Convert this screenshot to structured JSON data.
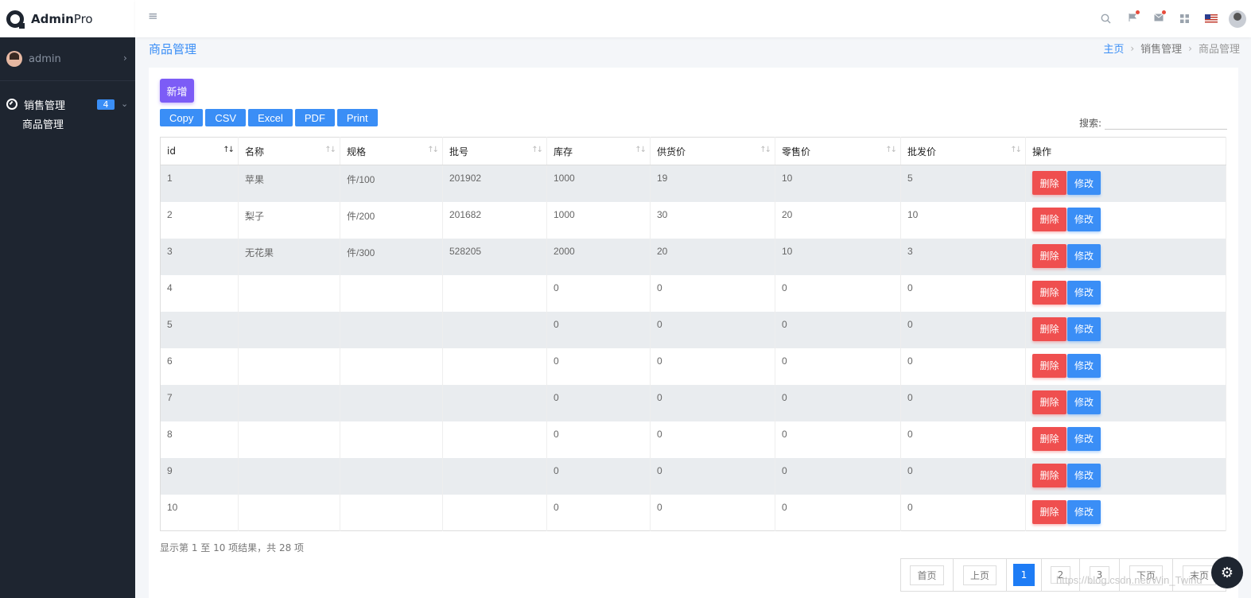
{
  "brand": {
    "name_bold": "Admin",
    "name_light": "Pro"
  },
  "topbar": {
    "icons": [
      "search-icon",
      "flag-icon",
      "mail-icon",
      "grid-icon",
      "us-flag-icon",
      "user-avatar"
    ]
  },
  "sidebar": {
    "user": "admin",
    "menu": {
      "label": "销售管理",
      "badge": "4",
      "items": [
        {
          "label": "商品管理"
        }
      ]
    }
  },
  "page": {
    "title": "商品管理"
  },
  "breadcrumb": {
    "home": "主页",
    "section": "销售管理",
    "current": "商品管理"
  },
  "toolbar": {
    "add_label": "新增",
    "export": [
      "Copy",
      "CSV",
      "Excel",
      "PDF",
      "Print"
    ],
    "search_label": "搜索:",
    "search_value": ""
  },
  "table": {
    "columns": [
      "id",
      "名称",
      "规格",
      "批号",
      "库存",
      "供货价",
      "零售价",
      "批发价",
      "操作"
    ],
    "delete_label": "删除",
    "edit_label": "修改",
    "rows": [
      [
        "1",
        "苹果",
        "件/100",
        "201902",
        "1000",
        "19",
        "10",
        "5"
      ],
      [
        "2",
        "梨子",
        "件/200",
        "201682",
        "1000",
        "30",
        "20",
        "10"
      ],
      [
        "3",
        "无花果",
        "件/300",
        "528205",
        "2000",
        "20",
        "10",
        "3"
      ],
      [
        "4",
        "",
        "",
        "",
        "0",
        "0",
        "0",
        "0"
      ],
      [
        "5",
        "",
        "",
        "",
        "0",
        "0",
        "0",
        "0"
      ],
      [
        "6",
        "",
        "",
        "",
        "0",
        "0",
        "0",
        "0"
      ],
      [
        "7",
        "",
        "",
        "",
        "0",
        "0",
        "0",
        "0"
      ],
      [
        "8",
        "",
        "",
        "",
        "0",
        "0",
        "0",
        "0"
      ],
      [
        "9",
        "",
        "",
        "",
        "0",
        "0",
        "0",
        "0"
      ],
      [
        "10",
        "",
        "",
        "",
        "0",
        "0",
        "0",
        "0"
      ]
    ]
  },
  "info": "显示第 1 至 10 项结果，共 28 项",
  "pagination": {
    "first": "首页",
    "prev": "上页",
    "pages": [
      "1",
      "2",
      "3"
    ],
    "current": "1",
    "next": "下页",
    "last": "末页"
  },
  "watermark": "https://blog.csdn.net/Win_Twind",
  "colors": {
    "accent": "#3a8ef6",
    "sidebar": "#1e2530",
    "add": "#7c5cf6",
    "delete": "#ef4f4f"
  }
}
